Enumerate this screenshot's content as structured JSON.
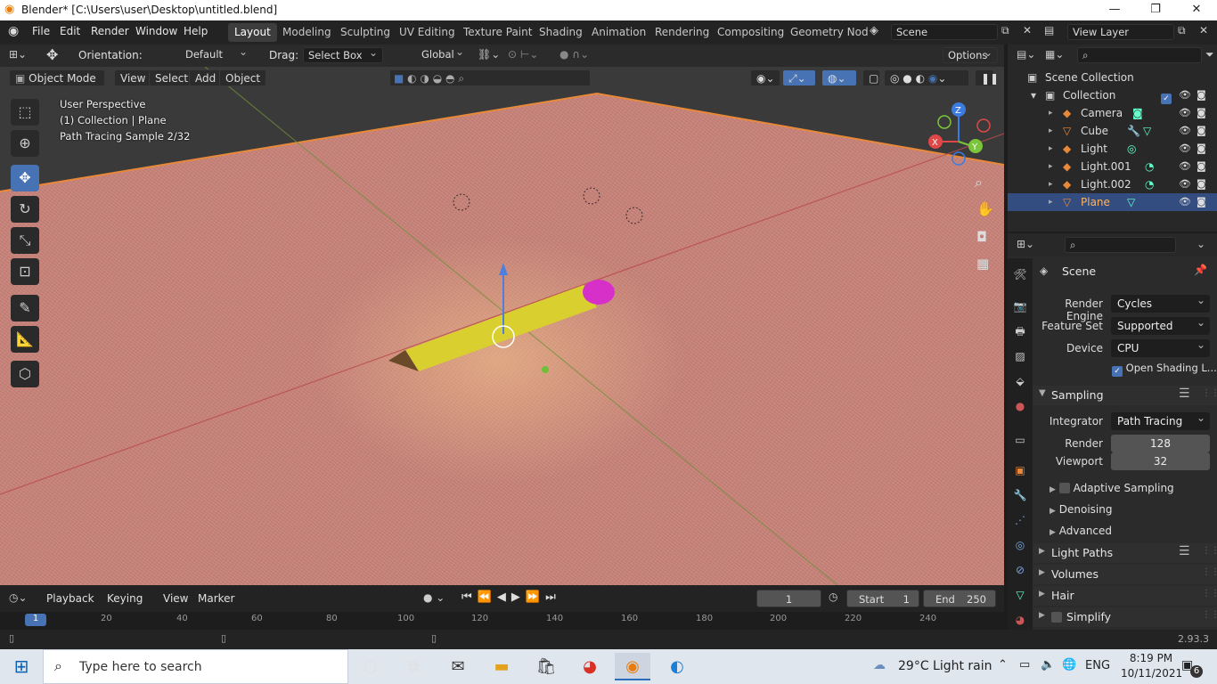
{
  "window": {
    "title": "Blender* [C:\\Users\\user\\Desktop\\untitled.blend]"
  },
  "menu": {
    "items": [
      "File",
      "Edit",
      "Render",
      "Window",
      "Help"
    ]
  },
  "workspaces": {
    "tabs": [
      "Layout",
      "Modeling",
      "Sculpting",
      "UV Editing",
      "Texture Paint",
      "Shading",
      "Animation",
      "Rendering",
      "Compositing",
      "Geometry Nod"
    ],
    "active": "Layout"
  },
  "scene_selector": {
    "value": "Scene"
  },
  "view_layer": {
    "value": "View Layer"
  },
  "tool_header": {
    "orientation_label": "Orientation:",
    "orientation_value": "Default",
    "drag_label": "Drag:",
    "drag_value": "Select Box",
    "transform_value": "Global",
    "options_label": "Options"
  },
  "viewport_header": {
    "mode": "Object Mode",
    "menus": [
      "View",
      "Select",
      "Add",
      "Object"
    ]
  },
  "viewport_overlay": {
    "line1": "User Perspective",
    "line2": "(1) Collection | Plane",
    "line3": "Path Tracing Sample 2/32"
  },
  "gizmo": {
    "x": "X",
    "y": "Y",
    "z": "Z"
  },
  "timeline": {
    "menus": [
      "Playback",
      "Keying",
      "View",
      "Marker"
    ],
    "current_frame": "1",
    "start_label": "Start",
    "start_value": "1",
    "end_label": "End",
    "end_value": "250",
    "ruler": [
      "1",
      "20",
      "40",
      "60",
      "80",
      "100",
      "120",
      "140",
      "160",
      "180",
      "200",
      "220",
      "240"
    ]
  },
  "outliner": {
    "root": "Scene Collection",
    "collection": "Collection",
    "items": [
      {
        "name": "Camera",
        "selected": false
      },
      {
        "name": "Cube",
        "selected": false
      },
      {
        "name": "Light",
        "selected": false
      },
      {
        "name": "Light.001",
        "selected": false
      },
      {
        "name": "Light.002",
        "selected": false
      },
      {
        "name": "Plane",
        "selected": true
      }
    ]
  },
  "properties": {
    "context": "Scene",
    "render_engine_label": "Render Engine",
    "render_engine": "Cycles",
    "feature_set_label": "Feature Set",
    "feature_set": "Supported",
    "device_label": "Device",
    "device": "CPU",
    "osl_label": "Open Shading L...",
    "sampling_label": "Sampling",
    "integrator_label": "Integrator",
    "integrator": "Path Tracing",
    "render_label": "Render",
    "render_samples": "128",
    "viewport_label": "Viewport",
    "viewport_samples": "32",
    "adaptive_label": "Adaptive Sampling",
    "denoising_label": "Denoising",
    "advanced_label": "Advanced",
    "light_paths_label": "Light Paths",
    "volumes_label": "Volumes",
    "hair_label": "Hair",
    "simplify_label": "Simplify"
  },
  "status": {
    "version": "2.93.3"
  },
  "taskbar": {
    "search_placeholder": "Type here to search",
    "weather": "29°C  Light rain",
    "language": "ENG",
    "time": "8:19 PM",
    "date": "10/11/2021",
    "notifications": "6"
  },
  "colors": {
    "accent": "#4772b3",
    "selection": "#334d80",
    "active_orange": "#e87d0d"
  }
}
